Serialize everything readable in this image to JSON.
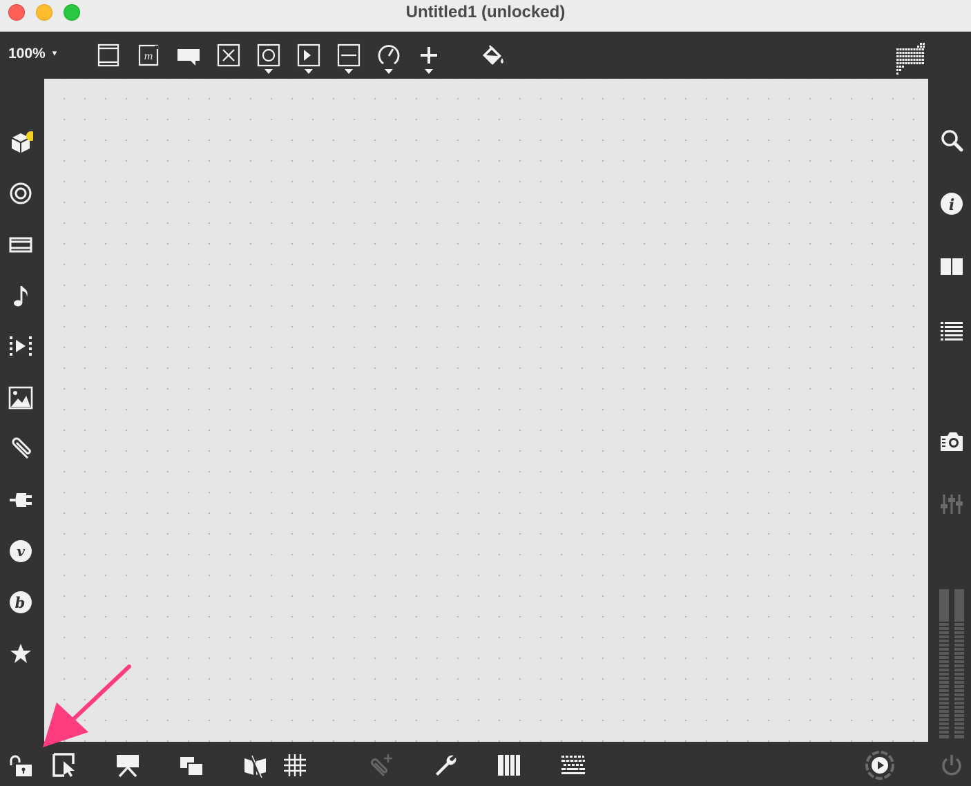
{
  "window": {
    "title": "Untitled1 (unlocked)"
  },
  "toolbar": {
    "zoom_label": "100%",
    "caret": "▾",
    "tools": [
      "bpatcher-icon",
      "message-icon",
      "comment-icon",
      "toggle-icon",
      "button-icon",
      "number-icon",
      "slider-icon",
      "dial-icon",
      "more-objects-icon",
      "paint-bucket-icon",
      "grid-icon"
    ]
  },
  "left_sidebar": {
    "items": [
      "packages-icon",
      "target-icon",
      "film-icon",
      "music-note-icon",
      "media-play-icon",
      "image-icon",
      "paperclip-icon",
      "plug-icon",
      "vimeo-icon",
      "b-icon",
      "star-icon"
    ],
    "notification_color": "#f5d21c"
  },
  "right_sidebar": {
    "items": [
      "search-icon",
      "info-icon",
      "split-view-icon",
      "list-icon",
      "camera-icon",
      "mixer-icon",
      "level-meter"
    ]
  },
  "bottom_bar": {
    "items": [
      "lock-icon",
      "presentation-mode-icon",
      "projector-icon",
      "layers-icon",
      "flag-icon",
      "grid-snap-icon",
      "paperclip-add-icon",
      "wrench-icon",
      "piano-icon",
      "keyboard-icon",
      "play-circle-icon",
      "power-icon"
    ]
  },
  "annotation": {
    "arrow_color": "#ff3c7f"
  },
  "colors": {
    "panel": "#333333",
    "icon": "#f2f2f2",
    "canvas": "#e6e6e6"
  }
}
